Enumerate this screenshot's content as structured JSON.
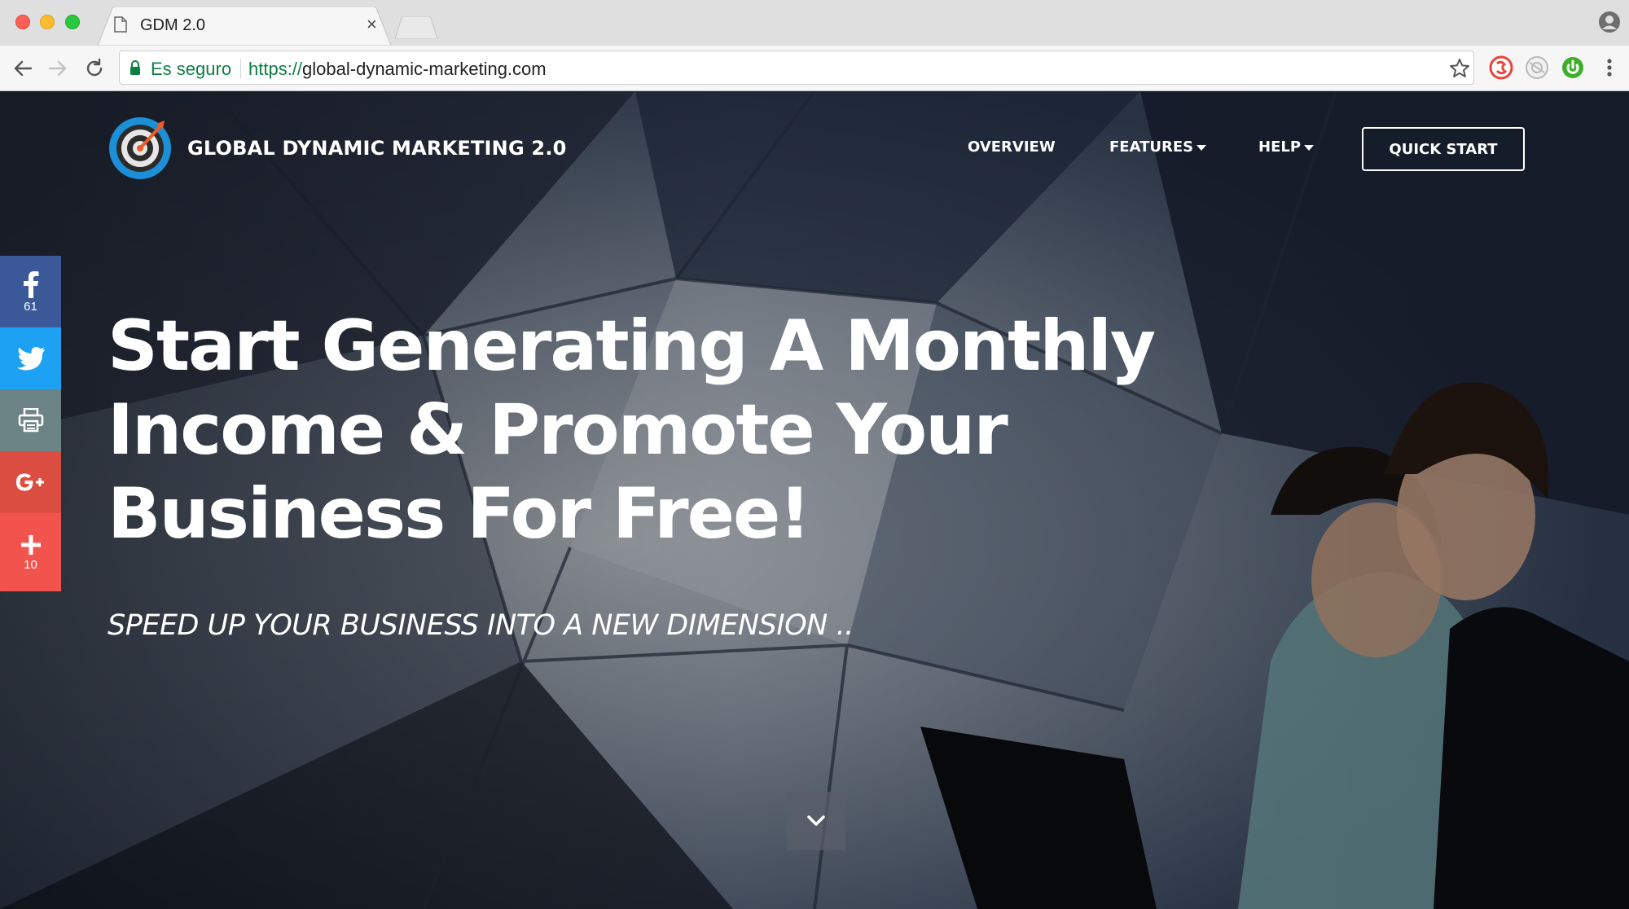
{
  "browser": {
    "tab_title": "GDM 2.0",
    "close_glyph": "×",
    "secure_label": "Es seguro",
    "url_scheme": "https://",
    "url_host": "global-dynamic-marketing.com"
  },
  "site": {
    "brand": "GLOBAL DYNAMIC MARKETING 2.0",
    "nav": {
      "overview": "OVERVIEW",
      "features": "FEATURES",
      "help": "HELP",
      "quick_start": "QUICK START"
    },
    "hero": {
      "headline_lines": [
        "Start Generating A Monthly",
        "Income & Promote Your",
        "Business For Free!"
      ],
      "subhead": "SPEED UP YOUR BUSINESS INTO A NEW DIMENSION .."
    },
    "social": [
      {
        "icon": "facebook-icon",
        "count": "61",
        "color": "#3b5998"
      },
      {
        "icon": "twitter-icon",
        "count": "",
        "color": "#1da1f2"
      },
      {
        "icon": "print-icon",
        "count": "",
        "color": "#6d8486"
      },
      {
        "icon": "google-plus-icon",
        "count": "",
        "color": "#dc4e41"
      },
      {
        "icon": "plus-icon",
        "count": "10",
        "color": "#f3534d"
      }
    ]
  },
  "colors": {
    "secure_green": "#0b8043",
    "brand_orange": "#f15a24",
    "brand_blue": "#1c8fd6"
  }
}
